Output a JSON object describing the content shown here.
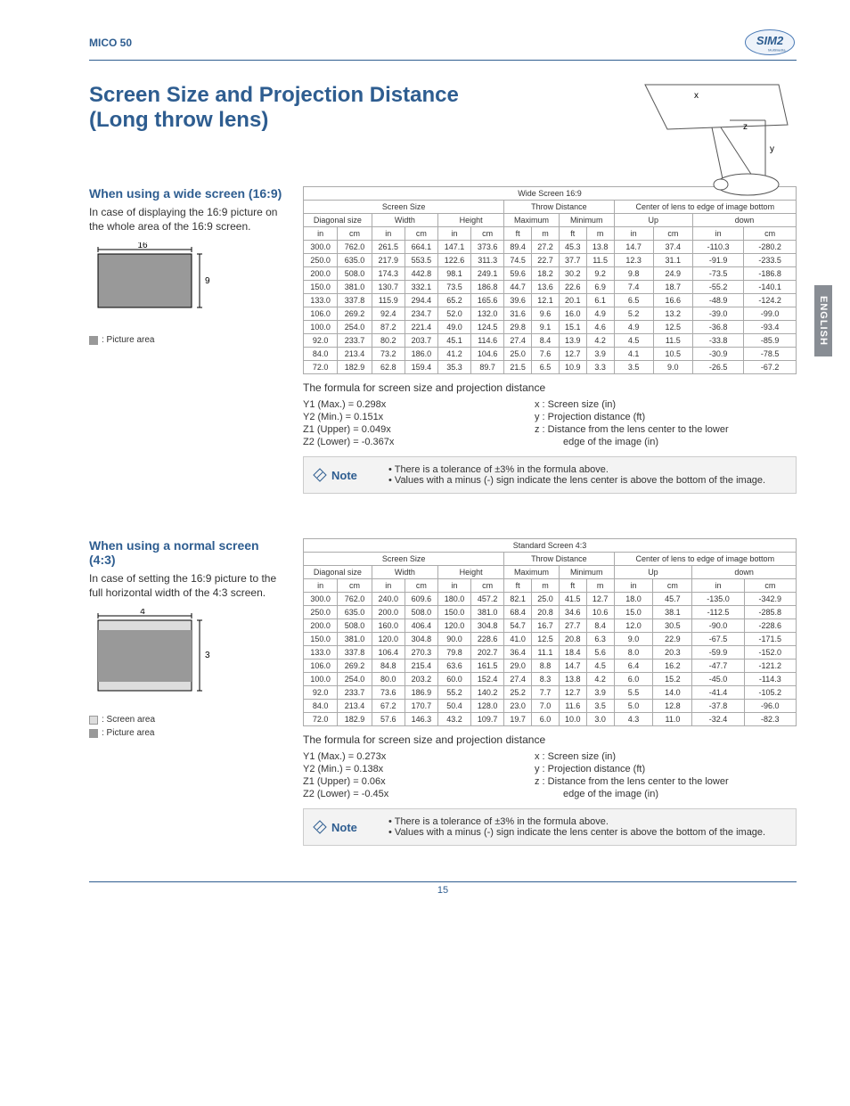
{
  "header": {
    "model": "MICO 50"
  },
  "sidetag": "ENGLISH",
  "title": "Screen Size and Projection Distance (Long throw lens)",
  "pagenum": "15",
  "sections": {
    "wide": {
      "heading": "When using a wide screen (16:9)",
      "desc": "In case of displaying the 16:9 picture on the whole area of the 16:9 screen.",
      "legend_picture": ": Picture area",
      "diag_w": "16",
      "diag_h": "9",
      "table_toplabel": "Wide Screen 16:9",
      "col_groups": [
        "Screen Size",
        "Throw Distance",
        "Center of lens to edge of image bottom"
      ],
      "col_subs": [
        "Diagonal size",
        "Width",
        "Height",
        "Maximum",
        "Minimum",
        "Up",
        "down"
      ],
      "units": [
        "in",
        "cm",
        "in",
        "cm",
        "in",
        "cm",
        "ft",
        "m",
        "ft",
        "m",
        "in",
        "cm",
        "in",
        "cm"
      ],
      "rows": [
        [
          "300.0",
          "762.0",
          "261.5",
          "664.1",
          "147.1",
          "373.6",
          "89.4",
          "27.2",
          "45.3",
          "13.8",
          "14.7",
          "37.4",
          "-110.3",
          "-280.2"
        ],
        [
          "250.0",
          "635.0",
          "217.9",
          "553.5",
          "122.6",
          "311.3",
          "74.5",
          "22.7",
          "37.7",
          "11.5",
          "12.3",
          "31.1",
          "-91.9",
          "-233.5"
        ],
        [
          "200.0",
          "508.0",
          "174.3",
          "442.8",
          "98.1",
          "249.1",
          "59.6",
          "18.2",
          "30.2",
          "9.2",
          "9.8",
          "24.9",
          "-73.5",
          "-186.8"
        ],
        [
          "150.0",
          "381.0",
          "130.7",
          "332.1",
          "73.5",
          "186.8",
          "44.7",
          "13.6",
          "22.6",
          "6.9",
          "7.4",
          "18.7",
          "-55.2",
          "-140.1"
        ],
        [
          "133.0",
          "337.8",
          "115.9",
          "294.4",
          "65.2",
          "165.6",
          "39.6",
          "12.1",
          "20.1",
          "6.1",
          "6.5",
          "16.6",
          "-48.9",
          "-124.2"
        ],
        [
          "106.0",
          "269.2",
          "92.4",
          "234.7",
          "52.0",
          "132.0",
          "31.6",
          "9.6",
          "16.0",
          "4.9",
          "5.2",
          "13.2",
          "-39.0",
          "-99.0"
        ],
        [
          "100.0",
          "254.0",
          "87.2",
          "221.4",
          "49.0",
          "124.5",
          "29.8",
          "9.1",
          "15.1",
          "4.6",
          "4.9",
          "12.5",
          "-36.8",
          "-93.4"
        ],
        [
          "92.0",
          "233.7",
          "80.2",
          "203.7",
          "45.1",
          "114.6",
          "27.4",
          "8.4",
          "13.9",
          "4.2",
          "4.5",
          "11.5",
          "-33.8",
          "-85.9"
        ],
        [
          "84.0",
          "213.4",
          "73.2",
          "186.0",
          "41.2",
          "104.6",
          "25.0",
          "7.6",
          "12.7",
          "3.9",
          "4.1",
          "10.5",
          "-30.9",
          "-78.5"
        ],
        [
          "72.0",
          "182.9",
          "62.8",
          "159.4",
          "35.3",
          "89.7",
          "21.5",
          "6.5",
          "10.9",
          "3.3",
          "3.5",
          "9.0",
          "-26.5",
          "-67.2"
        ]
      ],
      "formula_title": "The formula for screen size and projection distance",
      "formulas_left": [
        "Y1 (Max.) = 0.298x",
        "Y2 (Min.) = 0.151x",
        "Z1 (Upper) = 0.049x",
        "Z2 (Lower) = -0.367x"
      ],
      "formulas_right_labels": [
        "x : Screen size (in)",
        "y : Projection distance (ft)",
        "z : Distance from the lens center to the lower"
      ],
      "formulas_right_cont": "edge of the image (in)",
      "note_label": "Note",
      "notes": [
        "There is a tolerance of ±3% in the formula above.",
        "Values with a minus (-) sign indicate the lens center is above the bottom of the image."
      ]
    },
    "norm": {
      "heading": "When using a normal screen (4:3)",
      "desc": "In case of setting the 16:9 picture to the full horizontal width of the 4:3 screen.",
      "legend_screen": ": Screen area",
      "legend_picture": ": Picture area",
      "diag_w": "4",
      "diag_h": "3",
      "table_toplabel": "Standard Screen 4:3",
      "col_groups": [
        "Screen Size",
        "Throw Distance",
        "Center of lens to edge of image bottom"
      ],
      "col_subs": [
        "Diagonal size",
        "Width",
        "Height",
        "Maximum",
        "Minimum",
        "Up",
        "down"
      ],
      "units": [
        "in",
        "cm",
        "in",
        "cm",
        "in",
        "cm",
        "ft",
        "m",
        "ft",
        "m",
        "in",
        "cm",
        "in",
        "cm"
      ],
      "rows": [
        [
          "300.0",
          "762.0",
          "240.0",
          "609.6",
          "180.0",
          "457.2",
          "82.1",
          "25.0",
          "41.5",
          "12.7",
          "18.0",
          "45.7",
          "-135.0",
          "-342.9"
        ],
        [
          "250.0",
          "635.0",
          "200.0",
          "508.0",
          "150.0",
          "381.0",
          "68.4",
          "20.8",
          "34.6",
          "10.6",
          "15.0",
          "38.1",
          "-112.5",
          "-285.8"
        ],
        [
          "200.0",
          "508.0",
          "160.0",
          "406.4",
          "120.0",
          "304.8",
          "54.7",
          "16.7",
          "27.7",
          "8.4",
          "12.0",
          "30.5",
          "-90.0",
          "-228.6"
        ],
        [
          "150.0",
          "381.0",
          "120.0",
          "304.8",
          "90.0",
          "228.6",
          "41.0",
          "12.5",
          "20.8",
          "6.3",
          "9.0",
          "22.9",
          "-67.5",
          "-171.5"
        ],
        [
          "133.0",
          "337.8",
          "106.4",
          "270.3",
          "79.8",
          "202.7",
          "36.4",
          "11.1",
          "18.4",
          "5.6",
          "8.0",
          "20.3",
          "-59.9",
          "-152.0"
        ],
        [
          "106.0",
          "269.2",
          "84.8",
          "215.4",
          "63.6",
          "161.5",
          "29.0",
          "8.8",
          "14.7",
          "4.5",
          "6.4",
          "16.2",
          "-47.7",
          "-121.2"
        ],
        [
          "100.0",
          "254.0",
          "80.0",
          "203.2",
          "60.0",
          "152.4",
          "27.4",
          "8.3",
          "13.8",
          "4.2",
          "6.0",
          "15.2",
          "-45.0",
          "-114.3"
        ],
        [
          "92.0",
          "233.7",
          "73.6",
          "186.9",
          "55.2",
          "140.2",
          "25.2",
          "7.7",
          "12.7",
          "3.9",
          "5.5",
          "14.0",
          "-41.4",
          "-105.2"
        ],
        [
          "84.0",
          "213.4",
          "67.2",
          "170.7",
          "50.4",
          "128.0",
          "23.0",
          "7.0",
          "11.6",
          "3.5",
          "5.0",
          "12.8",
          "-37.8",
          "-96.0"
        ],
        [
          "72.0",
          "182.9",
          "57.6",
          "146.3",
          "43.2",
          "109.7",
          "19.7",
          "6.0",
          "10.0",
          "3.0",
          "4.3",
          "11.0",
          "-32.4",
          "-82.3"
        ]
      ],
      "formula_title": "The formula for screen size and projection distance",
      "formulas_left": [
        "Y1 (Max.) = 0.273x",
        "Y2 (Min.) = 0.138x",
        "Z1 (Upper) = 0.06x",
        "Z2 (Lower) = -0.45x"
      ],
      "formulas_right_labels": [
        "x : Screen size (in)",
        "y : Projection distance (ft)",
        "z : Distance from the lens center to the lower"
      ],
      "formulas_right_cont": "edge of the image (in)",
      "note_label": "Note",
      "notes": [
        "There is a tolerance of ±3% in the formula above.",
        "Values with a minus (-) sign indicate the lens center is above the bottom of the image."
      ]
    }
  }
}
